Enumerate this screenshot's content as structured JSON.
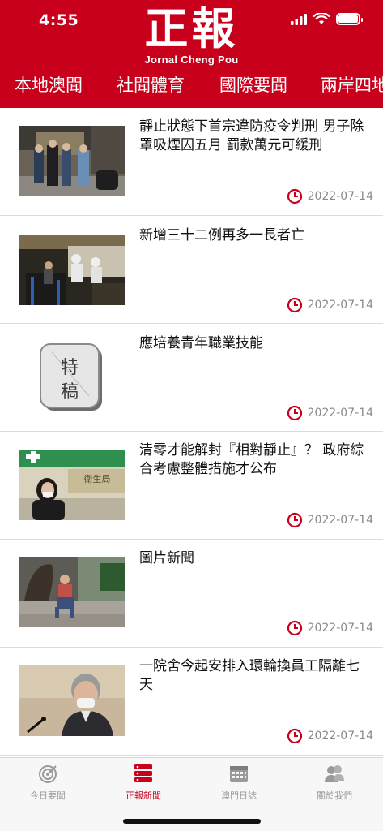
{
  "status_bar": {
    "time": "4:55"
  },
  "header": {
    "logo_text": "正報",
    "logo_subtitle": "Jornal Cheng Pou",
    "brand_color": "#c8001c"
  },
  "category_tabs": [
    {
      "label": "本地澳聞"
    },
    {
      "label": "社聞體育"
    },
    {
      "label": "國際要聞"
    },
    {
      "label": "兩岸四地"
    }
  ],
  "articles": [
    {
      "title": "靜止狀態下首宗違防疫令判刑 男子除罩吸煙囚五月 罰款萬元可緩刑",
      "date": "2022-07-14",
      "thumbnail": "police-scene-photo"
    },
    {
      "title": "新增三十二例再多一長者亡",
      "date": "2022-07-14",
      "thumbnail": "testing-station-photo"
    },
    {
      "title": "應培養青年職業技能",
      "date": "2022-07-14",
      "thumbnail": "feature-stamp-image",
      "thumb_text": "特稿"
    },
    {
      "title": "清零才能解封『相對靜止』？ 政府綜合考慮整體措施才公布",
      "date": "2022-07-14",
      "thumbnail": "health-bureau-photo",
      "thumb_text": "衛生局"
    },
    {
      "title": "圖片新聞",
      "date": "2022-07-14",
      "thumbnail": "street-photo"
    },
    {
      "title": "一院舍今起安排入環輪換員工隔離七天",
      "date": "2022-07-14",
      "thumbnail": "press-conference-photo"
    }
  ],
  "bottom_tabs": [
    {
      "label": "今日要聞",
      "icon": "target-icon",
      "active": false
    },
    {
      "label": "正報新聞",
      "icon": "news-stack-icon",
      "active": true
    },
    {
      "label": "澳門日誌",
      "icon": "calendar-icon",
      "active": false
    },
    {
      "label": "關於我們",
      "icon": "people-icon",
      "active": false
    }
  ]
}
